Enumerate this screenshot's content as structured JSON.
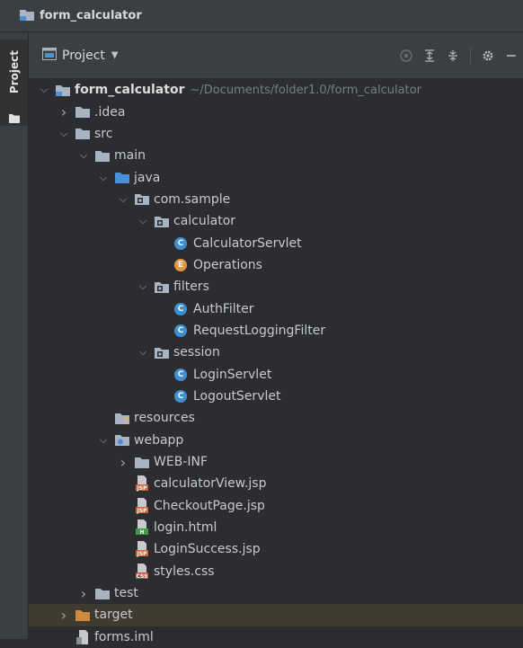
{
  "window": {
    "title": "form_calculator"
  },
  "toolstrip": {
    "tab_label": "Project"
  },
  "panel": {
    "title": "Project"
  },
  "tree": [
    {
      "depth": 0,
      "arrow": "down",
      "icon": "module-folder",
      "label": "form_calculator",
      "bold": true,
      "path": "~/Documents/folder1.0/form_calculator"
    },
    {
      "depth": 1,
      "arrow": "right",
      "icon": "folder",
      "label": ".idea"
    },
    {
      "depth": 1,
      "arrow": "down",
      "icon": "folder",
      "label": "src"
    },
    {
      "depth": 2,
      "arrow": "down",
      "icon": "folder",
      "label": "main"
    },
    {
      "depth": 3,
      "arrow": "down",
      "icon": "source-folder",
      "label": "java"
    },
    {
      "depth": 4,
      "arrow": "down",
      "icon": "package",
      "label": "com.sample"
    },
    {
      "depth": 5,
      "arrow": "down",
      "icon": "package",
      "label": "calculator"
    },
    {
      "depth": 6,
      "arrow": "none",
      "icon": "class",
      "label": "CalculatorServlet"
    },
    {
      "depth": 6,
      "arrow": "none",
      "icon": "enum",
      "label": "Operations"
    },
    {
      "depth": 5,
      "arrow": "down",
      "icon": "package",
      "label": "filters"
    },
    {
      "depth": 6,
      "arrow": "none",
      "icon": "class",
      "label": "AuthFilter"
    },
    {
      "depth": 6,
      "arrow": "none",
      "icon": "class",
      "label": "RequestLoggingFilter"
    },
    {
      "depth": 5,
      "arrow": "down",
      "icon": "package",
      "label": "session"
    },
    {
      "depth": 6,
      "arrow": "none",
      "icon": "class",
      "label": "LoginServlet"
    },
    {
      "depth": 6,
      "arrow": "none",
      "icon": "class",
      "label": "LogoutServlet"
    },
    {
      "depth": 3,
      "arrow": "none",
      "icon": "resources-folder",
      "label": "resources"
    },
    {
      "depth": 3,
      "arrow": "down",
      "icon": "web-folder",
      "label": "webapp"
    },
    {
      "depth": 4,
      "arrow": "right",
      "icon": "folder",
      "label": "WEB-INF"
    },
    {
      "depth": 4,
      "arrow": "none",
      "icon": "jsp-file",
      "label": "calculatorView.jsp"
    },
    {
      "depth": 4,
      "arrow": "none",
      "icon": "jsp-file",
      "label": "CheckoutPage.jsp"
    },
    {
      "depth": 4,
      "arrow": "none",
      "icon": "html-file",
      "label": "login.html"
    },
    {
      "depth": 4,
      "arrow": "none",
      "icon": "jsp-file",
      "label": "LoginSuccess.jsp"
    },
    {
      "depth": 4,
      "arrow": "none",
      "icon": "css-file",
      "label": "styles.css"
    },
    {
      "depth": 2,
      "arrow": "right",
      "icon": "folder",
      "label": "test"
    },
    {
      "depth": 1,
      "arrow": "right",
      "icon": "excluded-folder",
      "label": "target",
      "selected": true
    },
    {
      "depth": 1,
      "arrow": "none",
      "icon": "iml-file",
      "label": "forms.iml"
    }
  ],
  "colors": {
    "background": "#2b2d30",
    "folder": "#a9b4c2",
    "source": "#4a90d9",
    "excluded": "#d08a3c",
    "class": "#3d8fd1",
    "enum": "#e69544"
  }
}
